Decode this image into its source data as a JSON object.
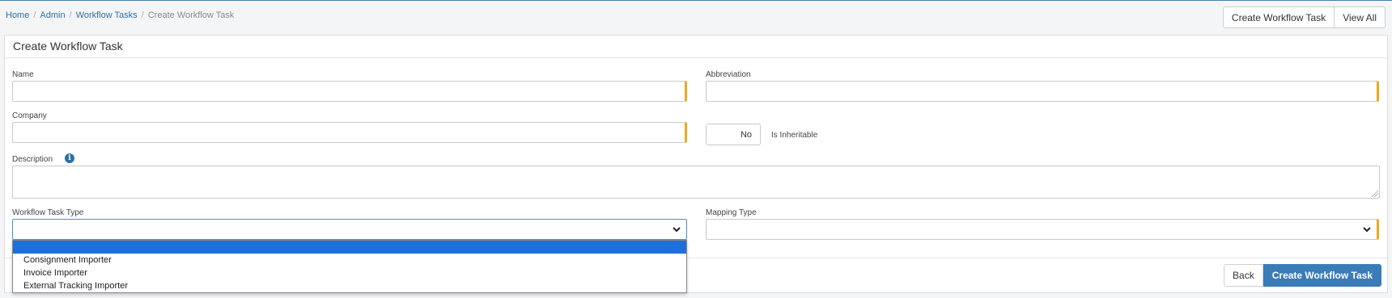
{
  "breadcrumb": {
    "home": "Home",
    "admin": "Admin",
    "workflow_tasks": "Workflow Tasks",
    "current": "Create Workflow Task"
  },
  "top_actions": {
    "create": "Create Workflow Task",
    "view_all": "View All"
  },
  "panel": {
    "title": "Create Workflow Task"
  },
  "form": {
    "name": {
      "label": "Name",
      "value": ""
    },
    "abbreviation": {
      "label": "Abbreviation",
      "value": ""
    },
    "company": {
      "label": "Company",
      "value": ""
    },
    "is_inheritable": {
      "label": "Is Inheritable",
      "value": "No"
    },
    "description": {
      "label": "Description",
      "value": ""
    },
    "workflow_task_type": {
      "label": "Workflow Task Type",
      "value": "",
      "options": [
        "",
        "Consignment Importer",
        "Invoice Importer",
        "External Tracking Importer"
      ]
    },
    "mapping_type": {
      "label": "Mapping Type",
      "value": ""
    }
  },
  "footer": {
    "back": "Back",
    "submit": "Create Workflow Task"
  },
  "colors": {
    "accent": "#3a7cb8",
    "required": "#f0a81c",
    "dropdown_highlight": "#1e6fd9"
  },
  "icons": {
    "info": "info-icon",
    "chevron": "chevron-down-icon"
  }
}
